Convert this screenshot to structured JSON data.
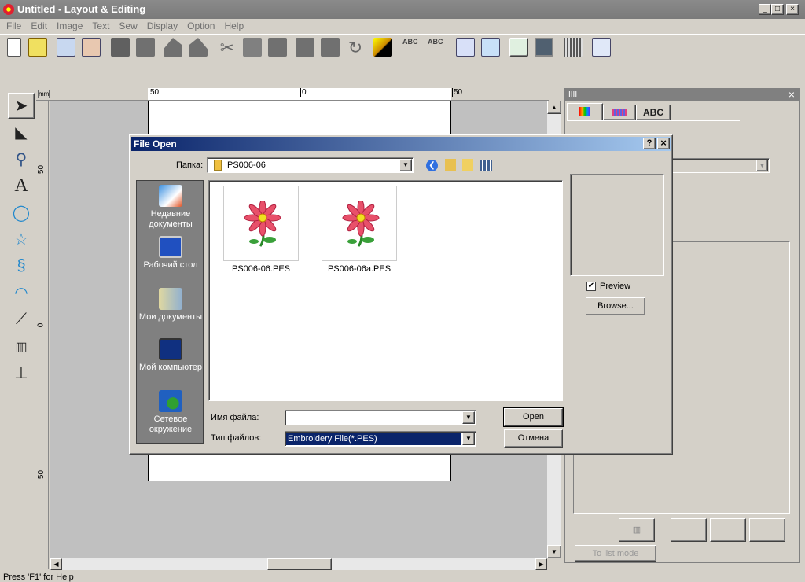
{
  "window": {
    "title": "Untitled - Layout & Editing",
    "min": "_",
    "max": "□",
    "close": "×"
  },
  "menu": [
    "File",
    "Edit",
    "Image",
    "Text",
    "Sew",
    "Display",
    "Option",
    "Help"
  ],
  "ruler": {
    "unit": "mm",
    "top_labels": [
      "50",
      "0",
      "50"
    ],
    "left_labels": [
      "50",
      "0",
      "50"
    ]
  },
  "tools": [
    "select-tool",
    "point-edit-tool",
    "zoom-tool",
    "text-tool",
    "shape-tool",
    "outline-tool",
    "hoop-tool",
    "fill-tool",
    "measure-tool",
    "stitch-tool",
    "stamp-tool"
  ],
  "right_panel": {
    "header": "IIII",
    "close": "×",
    "tabs": [
      "",
      "",
      "ABC"
    ],
    "list_mode": "To list mode"
  },
  "dialog": {
    "title": "File Open",
    "help": "?",
    "close": "×",
    "folder_label": "Папка:",
    "folder_value": "PS006-06",
    "places": [
      "Недавние документы",
      "Рабочий стол",
      "Мои документы",
      "Мой компьютер",
      "Сетевое окружение"
    ],
    "files": [
      "PS006-06.PES",
      "PS006-06a.PES"
    ],
    "preview_label": "Preview",
    "preview_checked": true,
    "browse": "Browse...",
    "filename_label": "Имя файла:",
    "filename_value": "",
    "filetype_label": "Тип файлов:",
    "filetype_value": "Embroidery File(*.PES)",
    "open": "Open",
    "cancel": "Отмена"
  },
  "status": "Press 'F1' for Help"
}
